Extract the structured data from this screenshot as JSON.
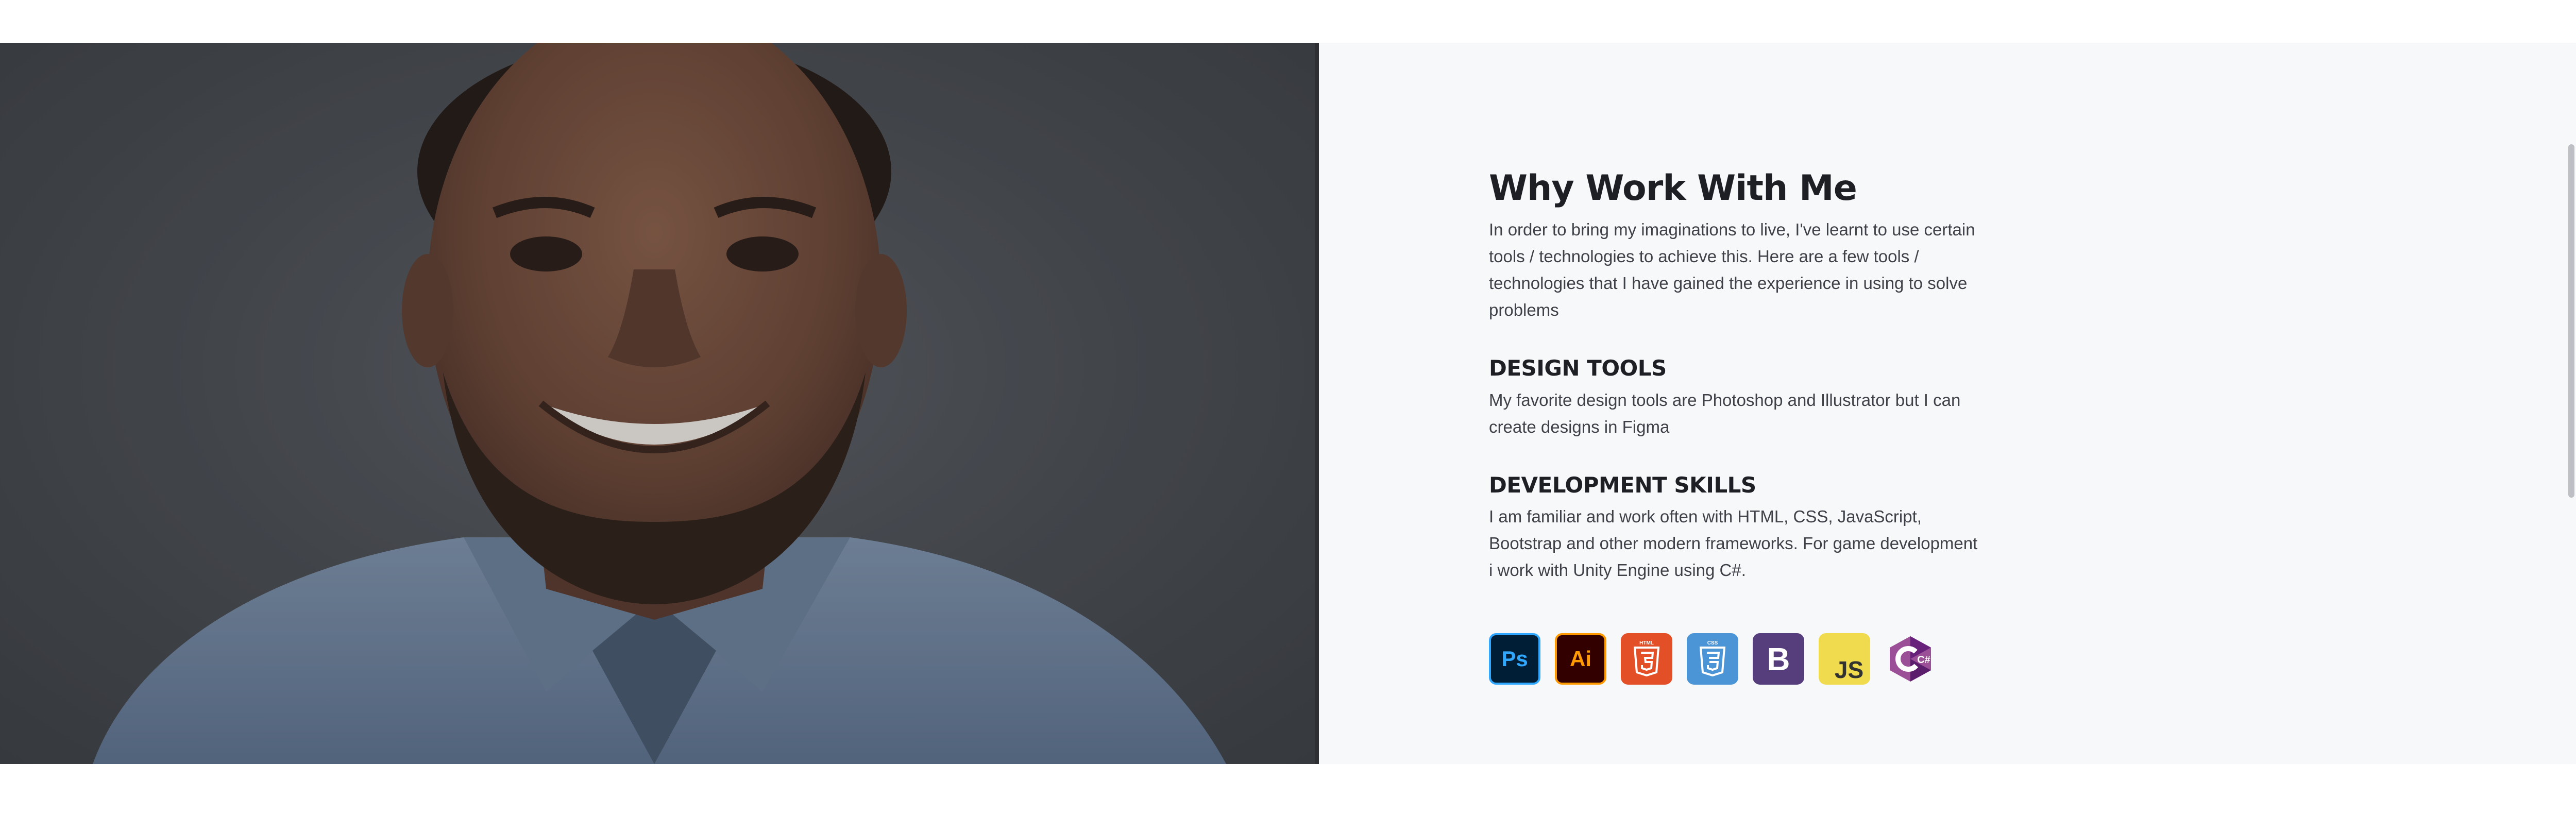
{
  "section": {
    "title": "Why Work With Me",
    "intro": "In order to bring my imaginations to live, I've learnt to use certain tools / technologies to achieve this. Here are a few tools / technologies that I have gained the experience in using to solve problems",
    "design_heading": "DESIGN TOOLS",
    "design_text": "My favorite design tools are Photoshop and Illustrator but I can create designs in Figma",
    "dev_heading": "DEVELOPMENT SKILLS",
    "dev_text": "I am familiar and work often with HTML, CSS, JavaScript, Bootstrap and other modern frameworks. For game development i work with Unity Engine using C#."
  },
  "tool_icons": [
    {
      "name": "photoshop-icon",
      "label": "Ps",
      "bg": "#001e36",
      "fg": "#31a8ff"
    },
    {
      "name": "illustrator-icon",
      "label": "Ai",
      "bg": "#330000",
      "fg": "#ff9a00"
    },
    {
      "name": "html5-icon",
      "label": "HTML",
      "bg": "#e34f26",
      "fg": "#ffffff"
    },
    {
      "name": "css3-icon",
      "label": "CSS",
      "bg": "#1572b6",
      "fg": "#ffffff"
    },
    {
      "name": "bootstrap-icon",
      "label": "B",
      "bg": "#563d7c",
      "fg": "#ffffff"
    },
    {
      "name": "javascript-icon",
      "label": "JS",
      "bg": "#f0db4f",
      "fg": "#323330"
    },
    {
      "name": "csharp-icon",
      "label": "C#",
      "bg": "#9b4f96",
      "fg": "#ffffff"
    }
  ],
  "colors": {
    "panel_bg": "#f7f8fa",
    "heading": "#1d1f24",
    "body_text": "#3e4147"
  }
}
